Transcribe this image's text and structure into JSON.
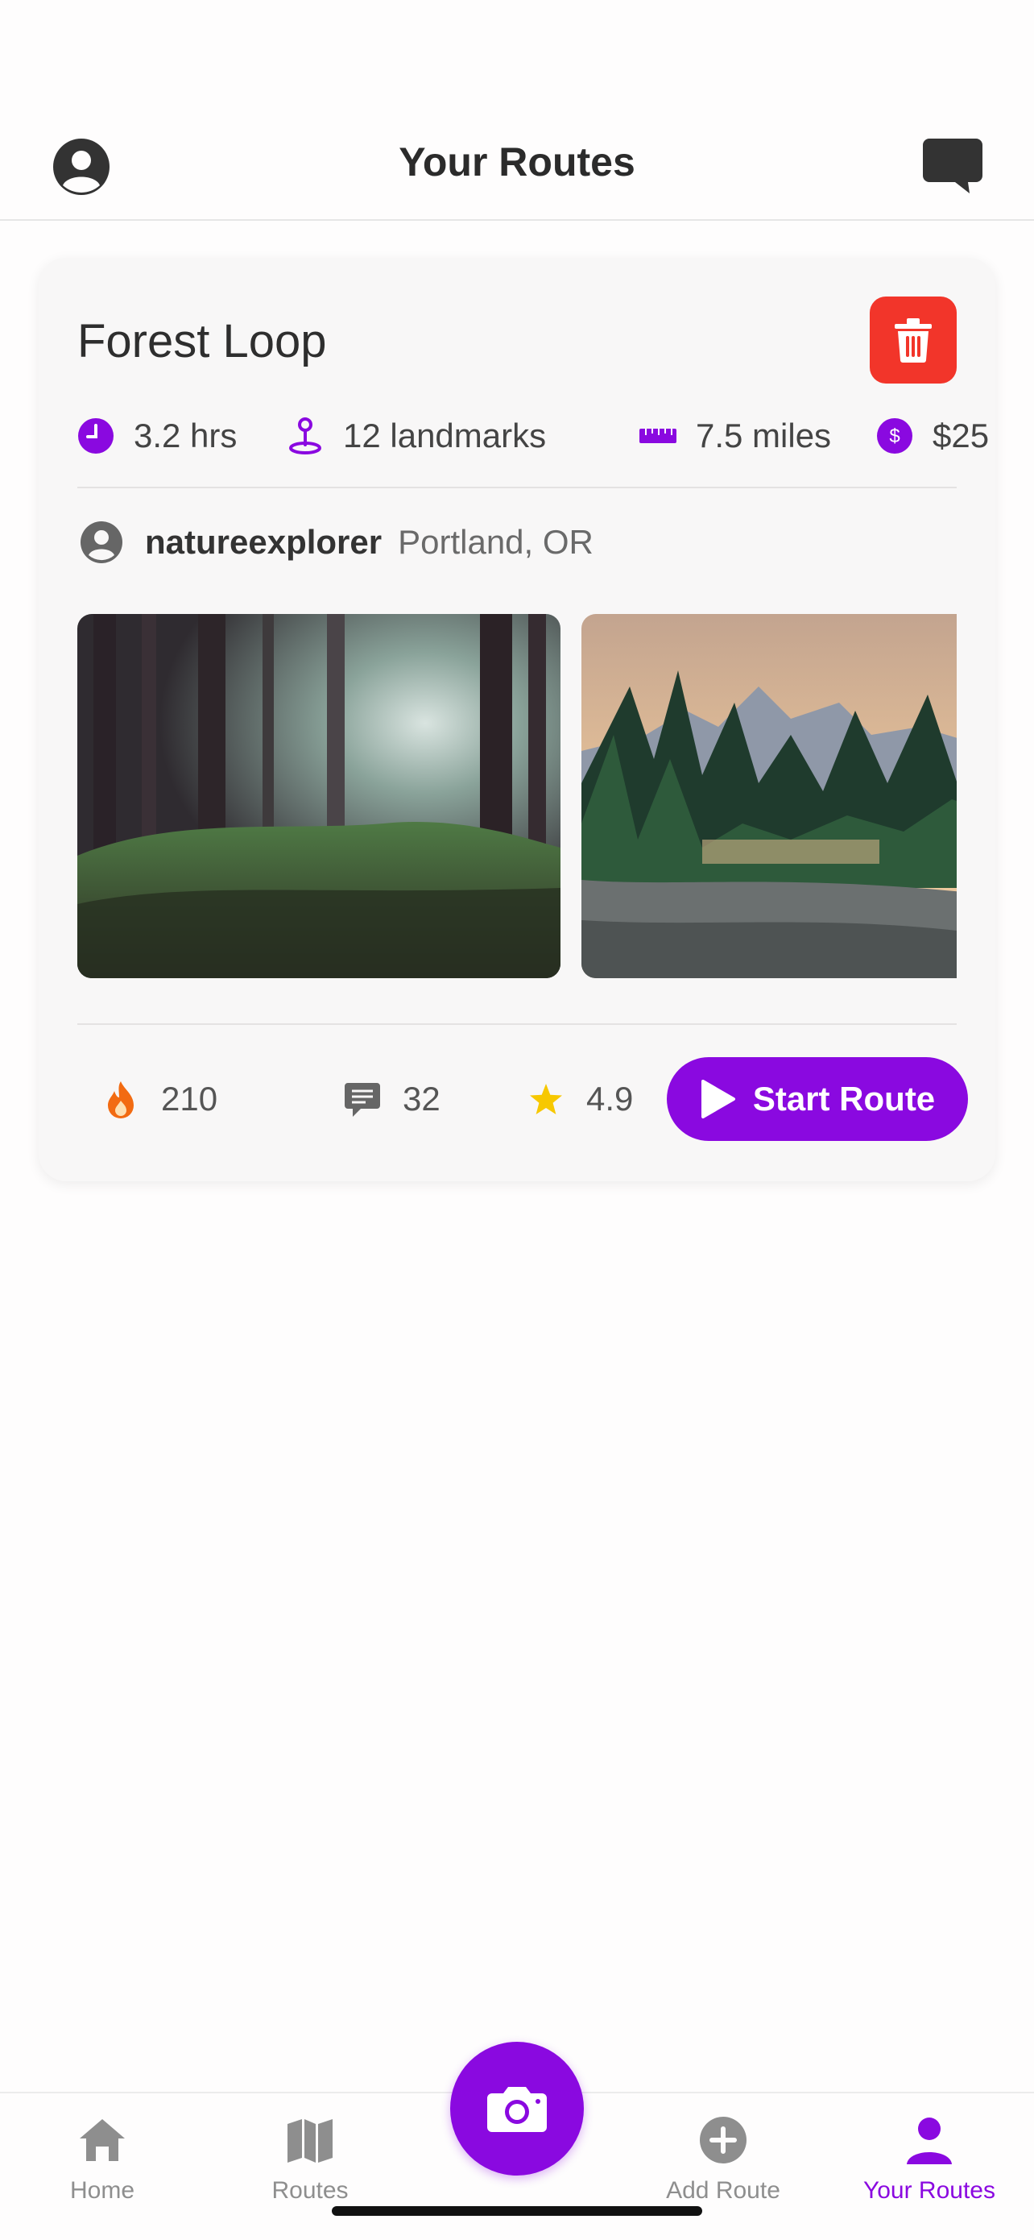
{
  "header": {
    "title": "Your Routes"
  },
  "route": {
    "title": "Forest Loop",
    "stats": {
      "duration": "3.2 hrs",
      "landmarks": "12 landmarks",
      "distance": "7.5 miles",
      "cost": "$25"
    },
    "author": {
      "username": "natureexplorer",
      "location": "Portland, OR"
    },
    "photos": [
      "forest-sunbeams",
      "mountain-lake-sunset"
    ],
    "likes": "210",
    "comments": "32",
    "rating": "4.9",
    "start_label": "Start Route"
  },
  "tabbar": {
    "items": [
      {
        "label": "Home",
        "icon": "home-icon",
        "active": false
      },
      {
        "label": "Routes",
        "icon": "map-icon",
        "active": false
      },
      {
        "label": "Add Route",
        "icon": "add-circle-icon",
        "active": false
      },
      {
        "label": "Your Routes",
        "icon": "person-icon",
        "active": true
      }
    ],
    "fab_icon": "camera-icon"
  },
  "colors": {
    "accent": "#8a09e0",
    "delete": "#f2352a",
    "flame": "#f26b12",
    "star": "#f7c800"
  }
}
